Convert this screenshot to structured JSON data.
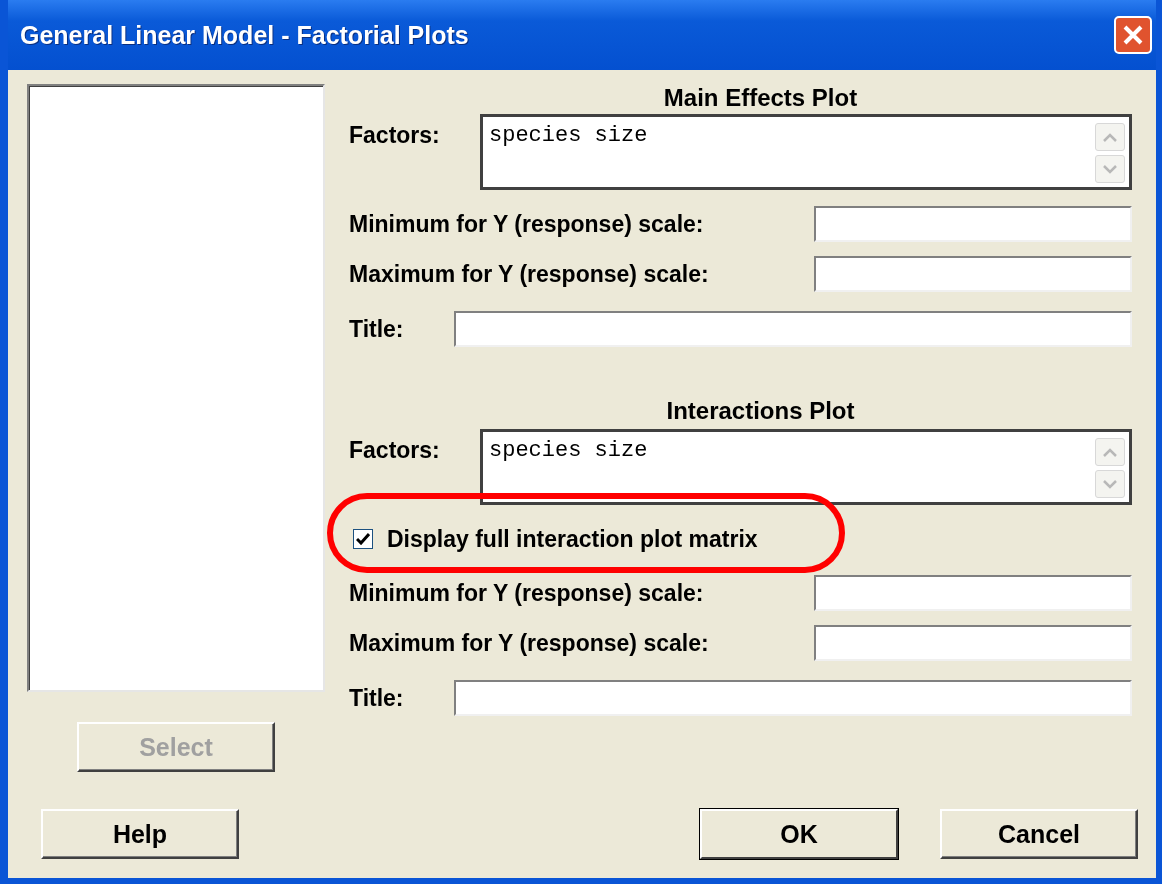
{
  "window": {
    "title": "General Linear Model - Factorial Plots"
  },
  "variables_list": {
    "select_button": {
      "label": "Select",
      "disabled": true
    }
  },
  "main_effects": {
    "heading": "Main Effects Plot",
    "factors_label": "Factors:",
    "factors_value": "species size",
    "fields": [
      {
        "label": "Minimum for Y (response) scale:",
        "kind": "short"
      },
      {
        "label": "Maximum for Y (response) scale:",
        "kind": "short"
      },
      {
        "label": "Title:",
        "kind": "long"
      }
    ]
  },
  "interactions": {
    "heading": "Interactions Plot",
    "factors_label": "Factors:",
    "factors_value": "species size",
    "checkbox": {
      "label": "Display full interaction plot matrix",
      "checked": true,
      "highlighted": true
    },
    "fields": [
      {
        "label": "Minimum for Y (response) scale:",
        "kind": "short"
      },
      {
        "label": "Maximum for Y (response) scale:",
        "kind": "short"
      },
      {
        "label": "Title:",
        "kind": "long"
      }
    ]
  },
  "buttons": {
    "help": "Help",
    "ok": "OK",
    "cancel": "Cancel"
  }
}
